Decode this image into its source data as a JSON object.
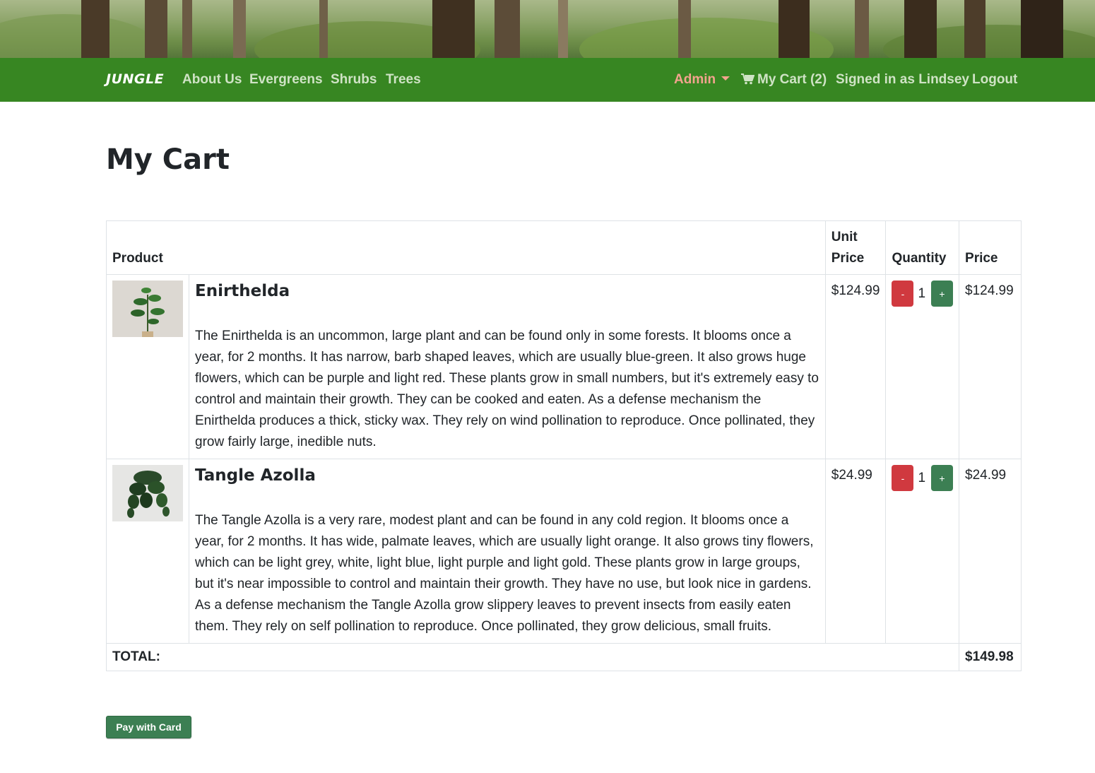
{
  "nav": {
    "brand": "JUNGLE",
    "links": [
      "About Us",
      "Evergreens",
      "Shrubs",
      "Trees"
    ],
    "admin": "Admin",
    "cart": "My Cart (2)",
    "signed_in": "Signed in as Lindsey",
    "logout": "Logout"
  },
  "page": {
    "title": "My Cart"
  },
  "table": {
    "headers": {
      "product": "Product",
      "unit_price": "Unit Price",
      "quantity": "Quantity",
      "price": "Price"
    },
    "items": [
      {
        "name": "Enirthelda",
        "description": "The Enirthelda is an uncommon, large plant and can be found only in some forests. It blooms once a year, for 2 months. It has narrow, barb shaped leaves, which are usually blue-green. It also grows huge flowers, which can be purple and light red. These plants grow in small numbers, but it's extremely easy to control and maintain their growth. They can be cooked and eaten. As a defense mechanism the Enirthelda produces a thick, sticky wax. They rely on wind pollination to reproduce. Once pollinated, they grow fairly large, inedible nuts.",
        "unit_price": "$124.99",
        "quantity": "1",
        "price": "$124.99",
        "minus": "-",
        "plus": "+"
      },
      {
        "name": "Tangle Azolla",
        "description": "The Tangle Azolla is a very rare, modest plant and can be found in any cold region. It blooms once a year, for 2 months. It has wide, palmate leaves, which are usually light orange. It also grows tiny flowers, which can be light grey, white, light blue, light purple and light gold. These plants grow in large groups, but it's near impossible to control and maintain their growth. They have no use, but look nice in gardens. As a defense mechanism the Tangle Azolla grow slippery leaves to prevent insects from easily eaten them. They rely on self pollination to reproduce. Once pollinated, they grow delicious, small fruits.",
        "unit_price": "$24.99",
        "quantity": "1",
        "price": "$24.99",
        "minus": "-",
        "plus": "+"
      }
    ],
    "total_label": "TOTAL:",
    "total_value": "$149.98"
  },
  "pay_button": "Pay with Card",
  "colors": {
    "navbar": "#378622",
    "admin": "#f3a48e",
    "minus": "#d0393f",
    "plus": "#3c7f53"
  }
}
